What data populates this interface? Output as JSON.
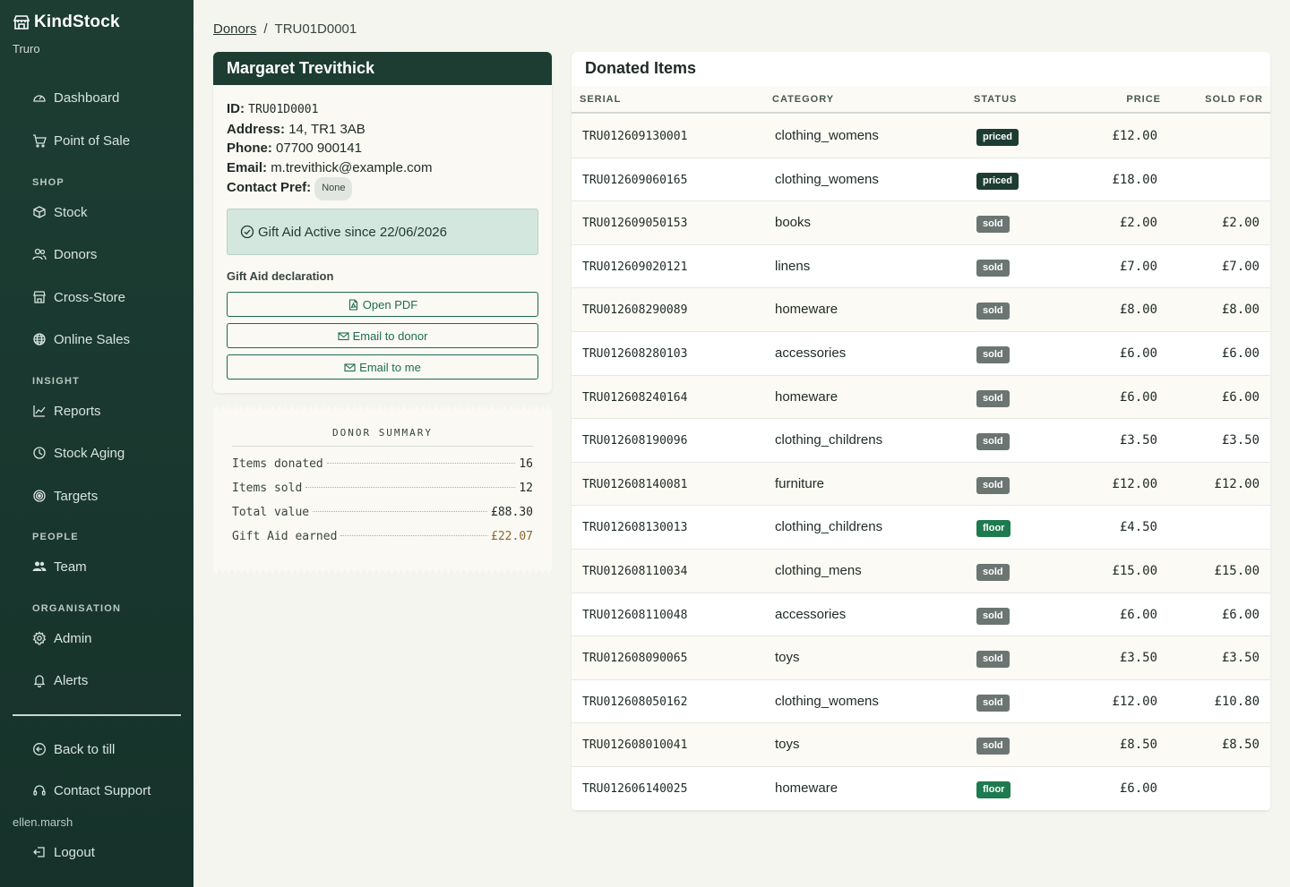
{
  "colors": {
    "sidebar_bg": "#1d3d33",
    "accent_green": "#1e6b55",
    "badge_priced": "#1d3d33",
    "badge_sold": "#6b7572",
    "badge_floor": "#1e7a4f",
    "gift_aid_earned": "#8a6a2e"
  },
  "sidebar": {
    "brand": "KindStock",
    "brand_icon": "store-icon",
    "store": "Truro",
    "items": [
      {
        "label": "Dashboard",
        "icon": "gauge-icon"
      },
      {
        "label": "Point of Sale",
        "icon": "cart-icon"
      },
      {
        "label": "Stock",
        "icon": "box-icon"
      },
      {
        "label": "Donors",
        "icon": "people-icon"
      },
      {
        "label": "Cross-Store",
        "icon": "shop-icon"
      },
      {
        "label": "Online Sales",
        "icon": "globe-icon"
      },
      {
        "label": "Reports",
        "icon": "chart-icon"
      },
      {
        "label": "Stock Aging",
        "icon": "clock-icon"
      },
      {
        "label": "Targets",
        "icon": "target-icon"
      },
      {
        "label": "Team",
        "icon": "team-icon"
      },
      {
        "label": "Admin",
        "icon": "gear-icon"
      },
      {
        "label": "Alerts",
        "icon": "bell-icon"
      },
      {
        "label": "Back to till",
        "icon": "arrow-left-circle-icon"
      },
      {
        "label": "Contact Support",
        "icon": "headset-icon"
      },
      {
        "label": "Logout",
        "icon": "logout-icon"
      }
    ],
    "sections": [
      "SHOP",
      "INSIGHT",
      "PEOPLE",
      "ORGANISATION"
    ],
    "username": "ellen.marsh"
  },
  "breadcrumb": {
    "parent": "Donors",
    "separator": "/",
    "current": "TRU01D0001"
  },
  "donor": {
    "name": "Margaret Trevithick",
    "id_label": "ID:",
    "id": "TRU01D0001",
    "address_label": "Address:",
    "address": "14, TR1 3AB",
    "phone_label": "Phone:",
    "phone": "07700 900141",
    "email_label": "Email:",
    "email": "m.trevithick@example.com",
    "contact_pref_label": "Contact Pref:",
    "contact_pref": "None",
    "gift_aid_status": "Gift Aid Active since 22/06/2026",
    "declaration_label": "Gift Aid declaration",
    "open_pdf": "Open PDF",
    "email_donor": "Email to donor",
    "email_me": "Email to me"
  },
  "summary": {
    "title": "DONOR SUMMARY",
    "rows": [
      {
        "label": "Items donated",
        "value": "16"
      },
      {
        "label": "Items sold",
        "value": "12"
      },
      {
        "label": "Total value",
        "value": "£88.30"
      },
      {
        "label": "Gift Aid earned",
        "value": "£22.07"
      }
    ]
  },
  "items": {
    "title": "Donated Items",
    "columns": [
      "SERIAL",
      "CATEGORY",
      "STATUS",
      "PRICE",
      "SOLD FOR"
    ],
    "rows": [
      {
        "serial": "TRU012609130001",
        "category": "clothing_womens",
        "status": "priced",
        "price": "£12.00",
        "sold_for": ""
      },
      {
        "serial": "TRU012609060165",
        "category": "clothing_womens",
        "status": "priced",
        "price": "£18.00",
        "sold_for": ""
      },
      {
        "serial": "TRU012609050153",
        "category": "books",
        "status": "sold",
        "price": "£2.00",
        "sold_for": "£2.00"
      },
      {
        "serial": "TRU012609020121",
        "category": "linens",
        "status": "sold",
        "price": "£7.00",
        "sold_for": "£7.00"
      },
      {
        "serial": "TRU012608290089",
        "category": "homeware",
        "status": "sold",
        "price": "£8.00",
        "sold_for": "£8.00"
      },
      {
        "serial": "TRU012608280103",
        "category": "accessories",
        "status": "sold",
        "price": "£6.00",
        "sold_for": "£6.00"
      },
      {
        "serial": "TRU012608240164",
        "category": "homeware",
        "status": "sold",
        "price": "£6.00",
        "sold_for": "£6.00"
      },
      {
        "serial": "TRU012608190096",
        "category": "clothing_childrens",
        "status": "sold",
        "price": "£3.50",
        "sold_for": "£3.50"
      },
      {
        "serial": "TRU012608140081",
        "category": "furniture",
        "status": "sold",
        "price": "£12.00",
        "sold_for": "£12.00"
      },
      {
        "serial": "TRU012608130013",
        "category": "clothing_childrens",
        "status": "floor",
        "price": "£4.50",
        "sold_for": ""
      },
      {
        "serial": "TRU012608110034",
        "category": "clothing_mens",
        "status": "sold",
        "price": "£15.00",
        "sold_for": "£15.00"
      },
      {
        "serial": "TRU012608110048",
        "category": "accessories",
        "status": "sold",
        "price": "£6.00",
        "sold_for": "£6.00"
      },
      {
        "serial": "TRU012608090065",
        "category": "toys",
        "status": "sold",
        "price": "£3.50",
        "sold_for": "£3.50"
      },
      {
        "serial": "TRU012608050162",
        "category": "clothing_womens",
        "status": "sold",
        "price": "£12.00",
        "sold_for": "£10.80"
      },
      {
        "serial": "TRU012608010041",
        "category": "toys",
        "status": "sold",
        "price": "£8.50",
        "sold_for": "£8.50"
      },
      {
        "serial": "TRU012606140025",
        "category": "homeware",
        "status": "floor",
        "price": "£6.00",
        "sold_for": ""
      }
    ]
  }
}
